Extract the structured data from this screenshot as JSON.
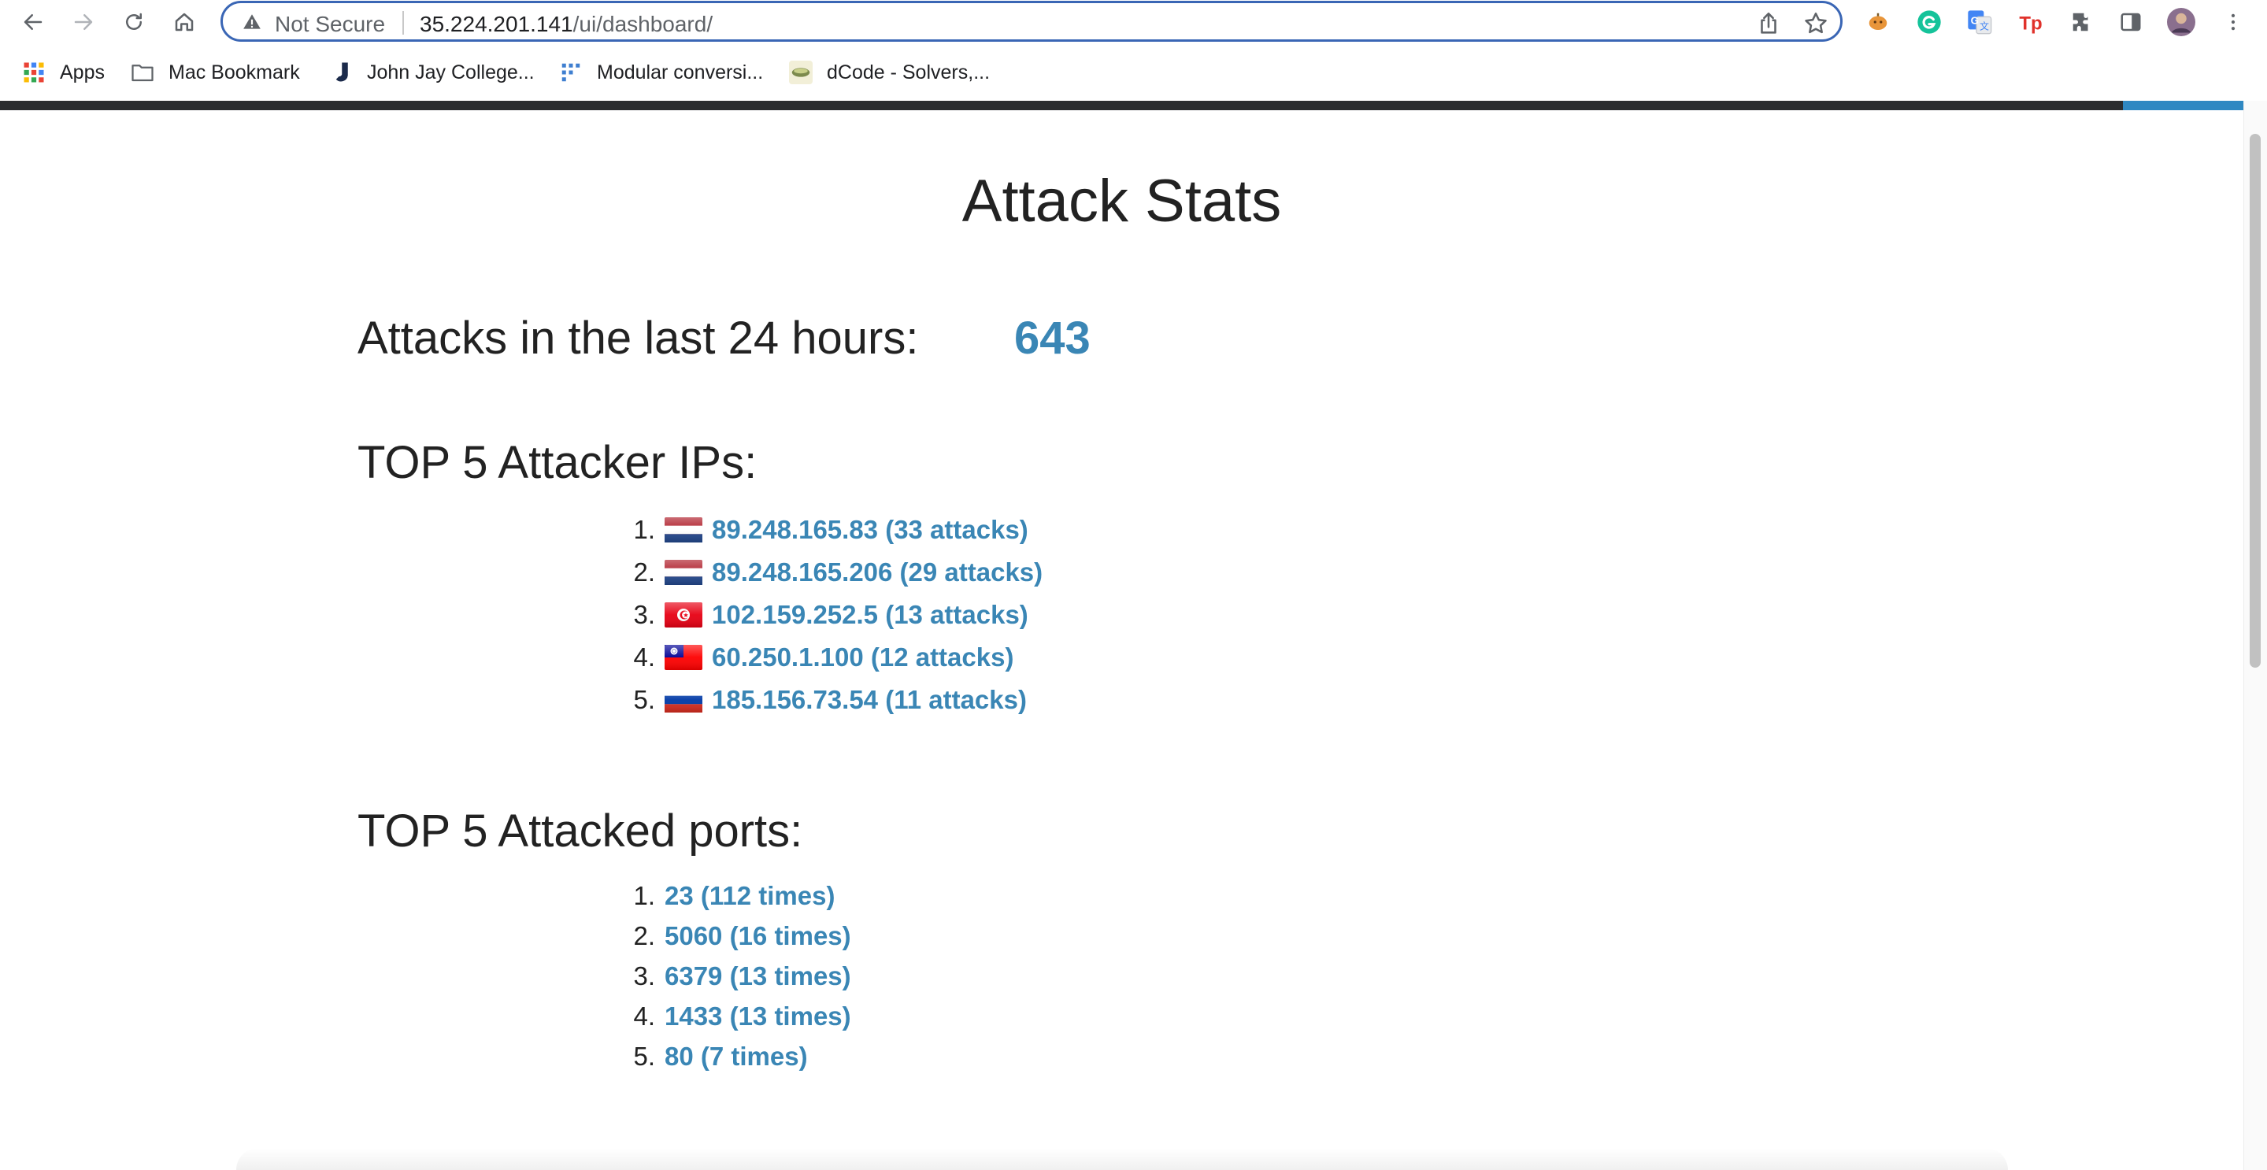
{
  "browser": {
    "address": {
      "security_label": "Not Secure",
      "url_host": "35.224.201.141",
      "url_path": "/ui/dashboard/"
    },
    "icons": [
      "back-icon",
      "forward-icon",
      "reload-icon",
      "home-icon",
      "share-icon",
      "bookmark-star-icon",
      "extensions-icon",
      "side-panel-icon",
      "profile-avatar",
      "menu-icon"
    ],
    "bookmarks": [
      {
        "label": "Apps",
        "icon": "apps-grid-icon"
      },
      {
        "label": "Mac Bookmark",
        "icon": "folder-icon"
      },
      {
        "label": "John Jay College...",
        "icon": "john-jay-icon"
      },
      {
        "label": "Modular conversi...",
        "icon": "modular-icon"
      },
      {
        "label": "dCode - Solvers,...",
        "icon": "dcode-icon"
      }
    ]
  },
  "page": {
    "title": "Attack Stats",
    "attacks_label": "Attacks in the last 24 hours:",
    "attacks_count": "643",
    "top_ips_heading": "TOP 5 Attacker IPs:",
    "top_ips": [
      {
        "num": "1.",
        "text": "89.248.165.83 (33 attacks)",
        "flag": "netherlands"
      },
      {
        "num": "2.",
        "text": "89.248.165.206 (29 attacks)",
        "flag": "netherlands"
      },
      {
        "num": "3.",
        "text": "102.159.252.5 (13 attacks)",
        "flag": "tunisia"
      },
      {
        "num": "4.",
        "text": "60.250.1.100 (12 attacks)",
        "flag": "taiwan"
      },
      {
        "num": "5.",
        "text": "185.156.73.54 (11 attacks)",
        "flag": "russia"
      }
    ],
    "top_ports_heading": "TOP 5 Attacked ports:",
    "top_ports": [
      {
        "num": "1.",
        "text": "23 (112 times)"
      },
      {
        "num": "2.",
        "text": "5060 (16 times)"
      },
      {
        "num": "3.",
        "text": "6379 (13 times)"
      },
      {
        "num": "4.",
        "text": "1433 (13 times)"
      },
      {
        "num": "5.",
        "text": "80 (7 times)"
      }
    ]
  },
  "colors": {
    "link": "#3a86b5",
    "omnibox_border": "#3a66b5",
    "top_strip": "#2b2d2f",
    "top_strip_accent": "#2f88c2"
  }
}
